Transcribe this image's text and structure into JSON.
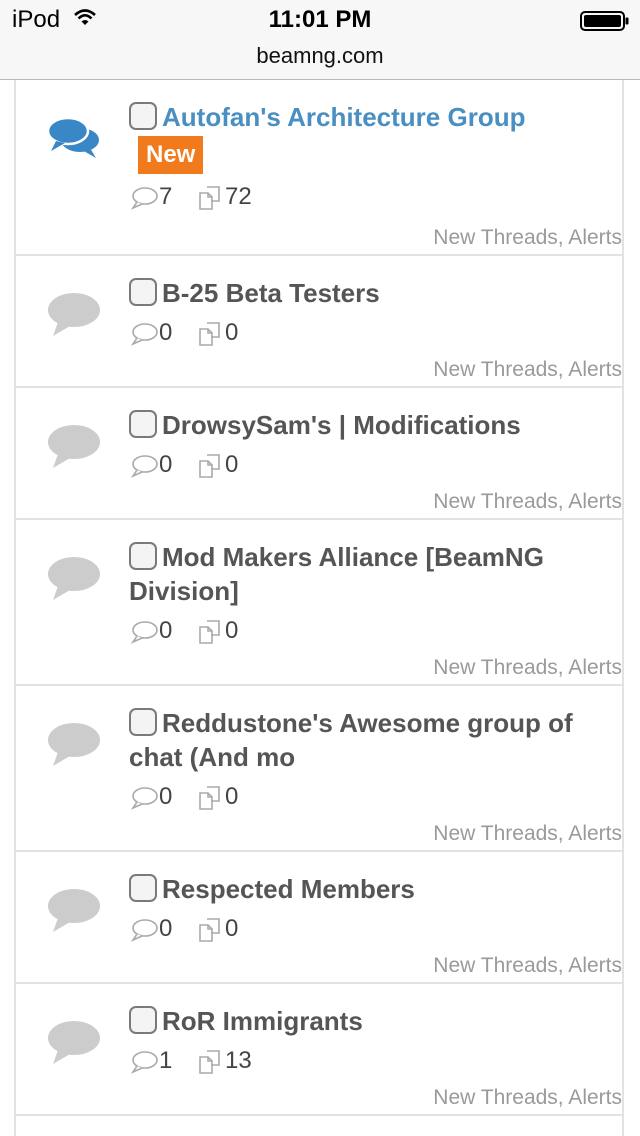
{
  "status_bar": {
    "device": "iPod",
    "time": "11:01 PM"
  },
  "browser": {
    "url": "beamng.com"
  },
  "nodes": [
    {
      "title": "Autofan's Architecture Group",
      "new_badge": "New",
      "discussions": "7",
      "messages": "72",
      "footer": "New Threads, Alerts",
      "unread": true
    },
    {
      "title": "B-25 Beta Testers",
      "discussions": "0",
      "messages": "0",
      "footer": "New Threads, Alerts",
      "unread": false
    },
    {
      "title": "DrowsySam's | Modifications",
      "discussions": "0",
      "messages": "0",
      "footer": "New Threads, Alerts",
      "unread": false
    },
    {
      "title": "Mod Makers Alliance [BeamNG Division]",
      "discussions": "0",
      "messages": "0",
      "footer": "New Threads, Alerts",
      "unread": false
    },
    {
      "title": "Reddustone's Awesome group of chat (And mo",
      "discussions": "0",
      "messages": "0",
      "footer": "New Threads, Alerts",
      "unread": false
    },
    {
      "title": "Respected Members",
      "discussions": "0",
      "messages": "0",
      "footer": "New Threads, Alerts",
      "unread": false
    },
    {
      "title": "RoR Immigrants",
      "discussions": "1",
      "messages": "13",
      "footer": "New Threads, Alerts",
      "unread": false
    }
  ],
  "icons": {
    "wifi": "wifi-icon",
    "battery": "battery-icon",
    "forum_unread": "chat-bubbles-icon",
    "forum_read": "chat-bubble-icon",
    "discussions": "speech-bubble-outline-icon",
    "messages": "pages-outline-icon"
  },
  "colors": {
    "link_unread": "#4a8fc1",
    "title_read": "#555555",
    "new_badge": "#f07a1c",
    "icon_read": "#cccccc",
    "icon_unread": "#3a87c8",
    "footer_text": "#9a9a9a"
  }
}
